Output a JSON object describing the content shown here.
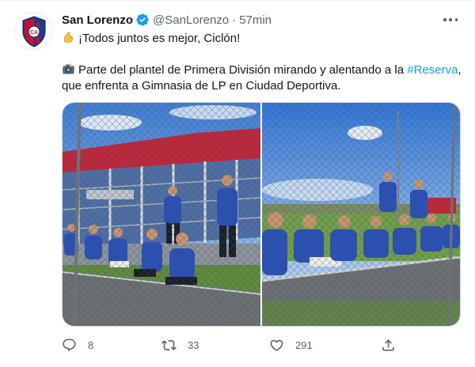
{
  "account": {
    "display_name": "San Lorenzo",
    "handle": "@SanLorenzo",
    "separator": "·",
    "time": "57min",
    "avatar_icon": "san-lorenzo-crest",
    "verified": true
  },
  "tweet": {
    "line1": "¡Todos juntos es mejor, Ciclón!",
    "line1_emoji": "flexed-biceps",
    "line2_pre": "Parte del plantel de Primera División mirando y alentando a la ",
    "line2_hashtag": "#Reserva",
    "line2_post": ", que enfrenta a Gimnasia de LP en Ciudad Deportiva.",
    "line2_emoji": "camera-with-flash"
  },
  "media": {
    "photos": [
      {
        "subject": "players-in-blue-jackets-behind-fence-stadium"
      },
      {
        "subject": "players-in-blue-jackets-behind-fence-field"
      }
    ]
  },
  "actions": {
    "reply_count": "8",
    "retweet_count": "33",
    "like_count": "291"
  },
  "colors": {
    "accent": "#1d9bf0",
    "muted": "#536471",
    "text": "#0f1419",
    "jacket_blue": "#2950b8"
  }
}
